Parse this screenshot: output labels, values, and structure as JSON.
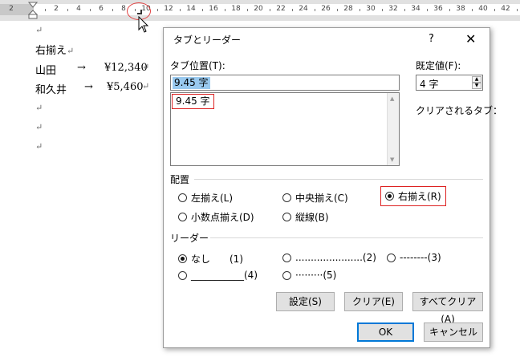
{
  "ruler": {
    "labels": [
      "2",
      "2",
      "4",
      "6",
      "8",
      "10",
      "12",
      "14",
      "16",
      "18",
      "20",
      "22",
      "24",
      "26",
      "28",
      "30",
      "32",
      "34",
      "36",
      "38",
      "40",
      "42"
    ]
  },
  "document": {
    "lines": [
      "↵",
      "右揃え↵",
      "山田　→　¥12,340↵",
      "和久井　→　¥5,460↵",
      "↵",
      "↵",
      "↵"
    ],
    "line1_name": "山田",
    "line1_arrow": "→",
    "line1_value": "¥12,340",
    "line2_name": "和久井",
    "line2_arrow": "→",
    "line2_value": "¥5,460",
    "heading": "右揃え",
    "para_mark": "↵"
  },
  "dialog": {
    "title": "タブとリーダー",
    "help": "?",
    "close": "✕",
    "tab_position_label": "タブ位置(T):",
    "tab_position_value": "9.45 字",
    "tab_list": [
      "9.45 字"
    ],
    "default_label": "既定値(F):",
    "default_value": "4 字",
    "clear_label": "クリアされるタブ：",
    "alignment": {
      "title": "配置",
      "options": [
        "左揃え(L)",
        "中央揃え(C)",
        "右揃え(R)",
        "小数点揃え(D)",
        "縦線(B)"
      ],
      "selected": "右揃え(R)"
    },
    "leader": {
      "title": "リーダー",
      "options": [
        "なし　　(1)",
        "......................(2)",
        "--------(3)",
        "___________(4)",
        "·········(5)"
      ],
      "selected": "なし　　(1)"
    },
    "buttons": {
      "set": "設定(S)",
      "clear": "クリア(E)",
      "clear_all": "すべてクリア(A)",
      "ok": "OK",
      "cancel": "キャンセル"
    }
  },
  "colors": {
    "highlight": "#d22222",
    "selection": "#99c9ef",
    "accent": "#0078d7"
  }
}
